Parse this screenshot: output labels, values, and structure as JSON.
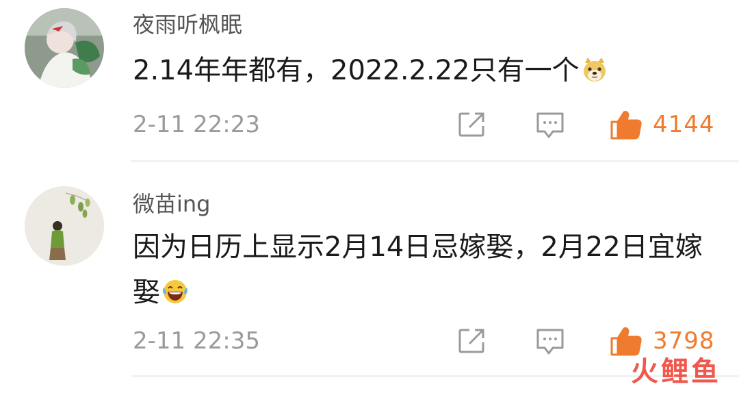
{
  "colors": {
    "accent": "#ef7b2e",
    "muted": "#9a9a9a",
    "watermark": "#f04a3e"
  },
  "comments": [
    {
      "username": "夜雨听枫眠",
      "text": "2.14年年都有，2022.2.22只有一个",
      "emoji": "doge-emoji",
      "time": "2-11 22:23",
      "likes": "4144"
    },
    {
      "username": "微苗ing",
      "text": "因为日历上显示2月14日忌嫁娶，2月22日宜嫁娶",
      "emoji": "laughing-tears-emoji",
      "time": "2-11 22:35",
      "likes": "3798"
    }
  ],
  "watermark": "火鲤鱼"
}
